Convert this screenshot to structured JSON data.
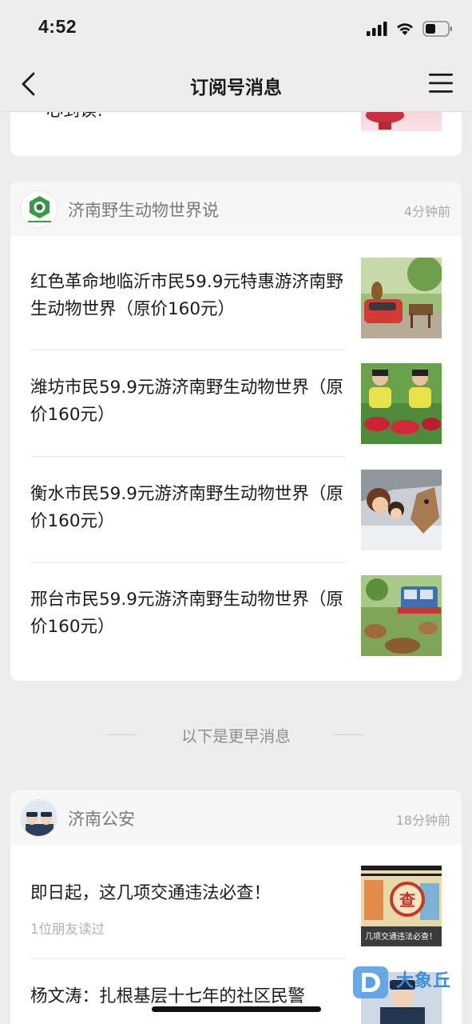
{
  "status_bar": {
    "time": "4:52"
  },
  "nav": {
    "title": "订阅号消息",
    "back_icon": "back-arrow-icon",
    "menu_icon": "menu-icon"
  },
  "top_card": {
    "partial_text": "心到读!"
  },
  "card1": {
    "account_name": "济南野生动物世界说",
    "time": "4分钟前",
    "items": [
      {
        "title": "红色革命地临沂市民59.9元特惠游济南野生动物世界（原价160元）"
      },
      {
        "title": "潍坊市民59.9元游济南野生动物世界（原价160元）"
      },
      {
        "title": "衡水市民59.9元游济南野生动物世界（原价160元）"
      },
      {
        "title": "邢台市民59.9元游济南野生动物世界（原价160元）"
      }
    ]
  },
  "separator": {
    "text": "以下是更早消息"
  },
  "card2": {
    "account_name": "济南公安",
    "time": "18分钟前",
    "items": [
      {
        "title": "即日起，这几项交通违法必查！",
        "subtitle": "1位朋友读过",
        "thumb_text": "查",
        "thumb_caption": "几项交通违法必查！"
      },
      {
        "title": "杨文涛：扎根基层十七年的社区民警"
      }
    ]
  },
  "watermark": {
    "text": "大象丘"
  },
  "colors": {
    "background": "#ededed",
    "card": "#ffffff",
    "card_header": "#f7f7f7",
    "meta_text": "#a8a8a8",
    "watermark_blue": "#3b8be0"
  }
}
